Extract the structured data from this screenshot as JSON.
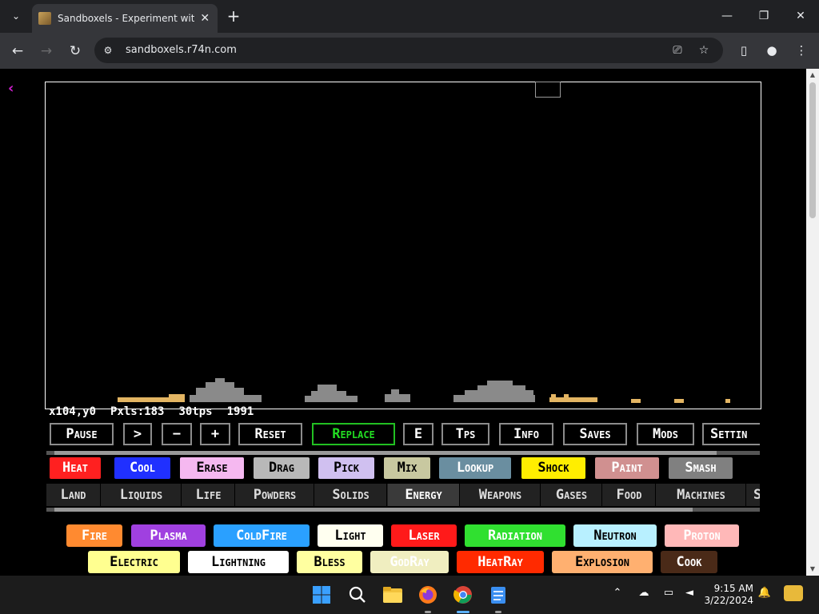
{
  "browser": {
    "tab_title": "Sandboxels - Experiment with P",
    "url": "sandboxels.r74n.com",
    "icons": {
      "tab_search": "chevron-down-icon",
      "tab_close": "close-icon",
      "new_tab": "plus-icon",
      "minimize": "minimize-icon",
      "maximize": "restore-icon",
      "close": "close-icon",
      "back": "back-arrow-icon",
      "forward": "forward-arrow-icon",
      "reload": "reload-icon",
      "site_info": "tune-icon",
      "install": "install-app-icon",
      "bookmark": "star-icon",
      "side_panel": "side-panel-icon",
      "profile": "profile-icon",
      "menu": "kebab-menu-icon"
    }
  },
  "game": {
    "stats": {
      "coords": "x104,y0",
      "pixels": "Pxls:183",
      "tps": "30tps",
      "ticks": "1991"
    },
    "controls": [
      "Pause",
      ">",
      "−",
      "+",
      "Reset",
      "Replace",
      "E",
      "Tps",
      "Info",
      "Saves",
      "Mods",
      "Settin"
    ],
    "active_control": "Replace",
    "tools": [
      {
        "label": "Heat",
        "bg": "#ff2020",
        "fg": "#ffffff"
      },
      {
        "label": "Cool",
        "bg": "#2030ff",
        "fg": "#ffffff"
      },
      {
        "label": "Erase",
        "bg": "#f5b8f0",
        "fg": "#000000"
      },
      {
        "label": "Drag",
        "bg": "#b8b8b8",
        "fg": "#000000"
      },
      {
        "label": "Pick",
        "bg": "#d0c0f0",
        "fg": "#000000"
      },
      {
        "label": "Mix",
        "bg": "#c8c8a0",
        "fg": "#000000"
      },
      {
        "label": "Lookup",
        "bg": "#6a8ea0",
        "fg": "#ffffff"
      },
      {
        "label": "Shock",
        "bg": "#ffee00",
        "fg": "#000000"
      },
      {
        "label": "Paint",
        "bg": "#d09090",
        "fg": "#ffffff"
      },
      {
        "label": "Smash",
        "bg": "#808080",
        "fg": "#ffffff"
      }
    ],
    "categories": [
      "Land",
      "Liquids",
      "Life",
      "Powders",
      "Solids",
      "Energy",
      "Weapons",
      "Gases",
      "Food",
      "Machines",
      "S"
    ],
    "active_category": "Energy",
    "elements_row1": [
      {
        "label": "Fire",
        "bg": "#ff8a30",
        "fg": "#ffffff"
      },
      {
        "label": "Plasma",
        "bg": "#a040e0",
        "fg": "#ffffff"
      },
      {
        "label": "ColdFire",
        "bg": "#2aa0ff",
        "fg": "#ffffff"
      },
      {
        "label": "Light",
        "bg": "#fffff0",
        "fg": "#000000"
      },
      {
        "label": "Laser",
        "bg": "#ff1a1a",
        "fg": "#ffffff"
      },
      {
        "label": "Radiation",
        "bg": "#30e030",
        "fg": "#ffffff"
      },
      {
        "label": "Neutron",
        "bg": "#b8f0ff",
        "fg": "#000000"
      },
      {
        "label": "Proton",
        "bg": "#ffb8b8",
        "fg": "#ffffff"
      }
    ],
    "elements_row2": [
      {
        "label": "Electric",
        "bg": "#ffff90",
        "fg": "#000000"
      },
      {
        "label": "Lightning",
        "bg": "#ffffff",
        "fg": "#000000"
      },
      {
        "label": "Bless",
        "bg": "#ffffa0",
        "fg": "#000000"
      },
      {
        "label": "GodRay",
        "bg": "#f0eec0",
        "fg": "#ffffff"
      },
      {
        "label": "HeatRay",
        "bg": "#ff2a00",
        "fg": "#ffffff"
      },
      {
        "label": "Explosion",
        "bg": "#ffb070",
        "fg": "#000000"
      },
      {
        "label": "Cook",
        "bg": "#4a2a18",
        "fg": "#ffffff"
      }
    ]
  },
  "taskbar": {
    "apps": [
      "windows-start-icon",
      "search-icon",
      "file-explorer-icon",
      "firefox-icon",
      "chrome-icon",
      "notepad-icon"
    ],
    "time": "9:15 AM",
    "date": "3/22/2024"
  }
}
